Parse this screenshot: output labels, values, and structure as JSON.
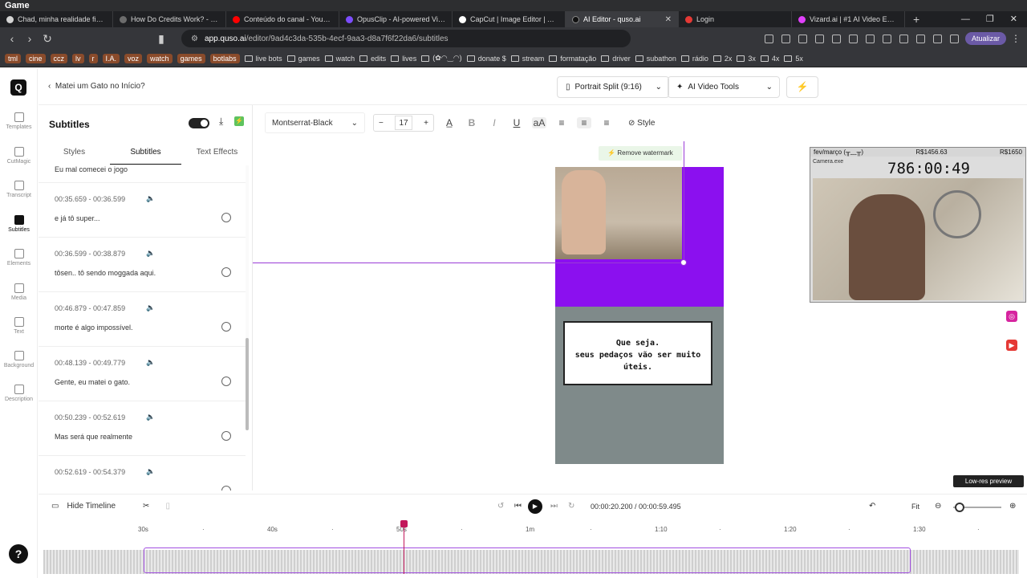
{
  "titlebar": {
    "title": "Game"
  },
  "tabs": [
    {
      "label": "Chad, minha realidade financeira",
      "color": "#d4d4d4"
    },
    {
      "label": "How Do Credits Work? - Opus",
      "color": "#6c6c6c"
    },
    {
      "label": "Conteúdo do canal - YouTube",
      "color": "#ff0000"
    },
    {
      "label": "OpusClip - AI-powered Video",
      "color": "#7c4dff"
    },
    {
      "label": "CapCut | Image Editor | All-In",
      "color": "#ffffff"
    },
    {
      "label": "AI Editor - quso.ai",
      "color": "#111111",
      "active": true
    },
    {
      "label": "Login",
      "color": "#e53935"
    },
    {
      "label": "Vizard.ai | #1 AI Video Editing",
      "color": "#e040fb"
    }
  ],
  "browser": {
    "url_host": "app.quso.ai",
    "url_path": "/editor/9ad4c3da-535b-4ecf-9aa3-d8a7f6f22da6/subtitles",
    "update_label": "Atualizar"
  },
  "bookmarks": [
    {
      "label": "tml",
      "chip": true
    },
    {
      "label": "cine",
      "chip": true
    },
    {
      "label": "ccz",
      "chip": true
    },
    {
      "label": "lv",
      "chip": true
    },
    {
      "label": "r",
      "chip": true
    },
    {
      "label": "I.A.",
      "chip": true
    },
    {
      "label": "voz",
      "chip": true
    },
    {
      "label": "watch",
      "chip": true
    },
    {
      "label": "games",
      "chip": true
    },
    {
      "label": "botlabs",
      "chip": true
    },
    {
      "label": "live bots"
    },
    {
      "label": "games"
    },
    {
      "label": "watch"
    },
    {
      "label": "edits"
    },
    {
      "label": "lives"
    },
    {
      "label": "(✿◠‿◠)"
    },
    {
      "label": "donate $"
    },
    {
      "label": "stream"
    },
    {
      "label": "formatação"
    },
    {
      "label": "driver"
    },
    {
      "label": "subathon"
    },
    {
      "label": "rádio"
    },
    {
      "label": "2x"
    },
    {
      "label": "3x"
    },
    {
      "label": "4x"
    },
    {
      "label": "5x"
    }
  ],
  "leftnav": [
    {
      "label": "Templates"
    },
    {
      "label": "CutMagic"
    },
    {
      "label": "Transcript"
    },
    {
      "label": "Subtitles",
      "active": true
    },
    {
      "label": "Elements"
    },
    {
      "label": "Media"
    },
    {
      "label": "Text"
    },
    {
      "label": "Background"
    },
    {
      "label": "Description"
    }
  ],
  "header": {
    "project_title": "Matei um Gato no Início?",
    "portrait_label": "Portrait Split (9:16)",
    "ai_tools_label": "AI Video Tools"
  },
  "panel": {
    "title": "Subtitles",
    "tabs": [
      "Styles",
      "Subtitles",
      "Text Effects"
    ],
    "first_text": "Eu mal comecei o jogo",
    "subtitles": [
      {
        "time": "00:35.659 - 00:36.599",
        "text": "e já tô super..."
      },
      {
        "time": "00:36.599 - 00:38.879",
        "text": "tôsen.. tô sendo moggada aqui."
      },
      {
        "time": "00:46.879 - 00:47.859",
        "text": "morte é algo impossível."
      },
      {
        "time": "00:48.139 - 00:49.779",
        "text": "Gente, eu matei o gato."
      },
      {
        "time": "00:50.239 - 00:52.619",
        "text": "Mas será que realmente"
      },
      {
        "time": "00:52.619 - 00:54.379",
        "text": ""
      }
    ]
  },
  "format": {
    "font": "Montserrat-Black",
    "size": "17",
    "style_label": "Style"
  },
  "canvas": {
    "remove_watermark": "Remove watermark",
    "bubble_line1": "Que seja.",
    "bubble_line2": "seus pedaços vão ser muito",
    "bubble_line3": "úteis.",
    "lowres": "Low-res preview"
  },
  "cam": {
    "label": "fev/março (╥﹏╥)",
    "money1": "R$1456.63",
    "money2": "R$1650",
    "app": "Camera.exe",
    "timer": "786:00:49"
  },
  "timeline": {
    "hide_label": "Hide Timeline",
    "timecode": "00:00:20.200 / 00:00:59.495",
    "fit": "Fit",
    "ruler": [
      "30s",
      "40s",
      "50s",
      "1m",
      "1:10",
      "1:20",
      "1:30"
    ]
  },
  "colors": {
    "accent": "#8b10ef",
    "playhead": "#c2185b"
  }
}
